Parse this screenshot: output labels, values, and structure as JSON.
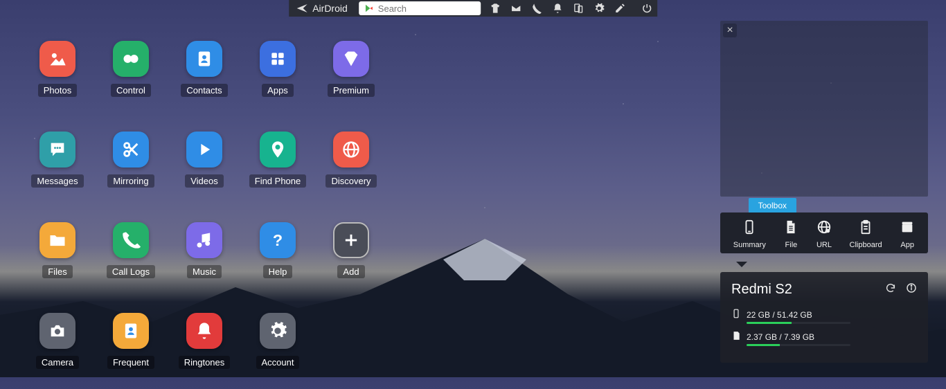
{
  "brand": {
    "name": "AirDroid"
  },
  "search": {
    "placeholder": "Search"
  },
  "apps": [
    {
      "label": "Photos",
      "name": "photos",
      "bg": "#ef5b4a",
      "icon": "photos"
    },
    {
      "label": "Control",
      "name": "control",
      "bg": "#25b06a",
      "icon": "binoculars"
    },
    {
      "label": "Contacts",
      "name": "contacts",
      "bg": "#2f8de6",
      "icon": "contact"
    },
    {
      "label": "Apps",
      "name": "apps",
      "bg": "#3c6fe0",
      "icon": "grid"
    },
    {
      "label": "Premium",
      "name": "premium",
      "bg": "#7d6be8",
      "icon": "diamond"
    },
    {
      "label": "Messages",
      "name": "messages",
      "bg": "#2f9fa8",
      "icon": "chat"
    },
    {
      "label": "Mirroring",
      "name": "mirroring",
      "bg": "#2f8de6",
      "icon": "scissors"
    },
    {
      "label": "Videos",
      "name": "videos",
      "bg": "#2f8de6",
      "icon": "play"
    },
    {
      "label": "Find Phone",
      "name": "find-phone",
      "bg": "#17b38f",
      "icon": "pin"
    },
    {
      "label": "Discovery",
      "name": "discovery",
      "bg": "#ef5b4a",
      "icon": "globe"
    },
    {
      "label": "Files",
      "name": "files",
      "bg": "#f4a93a",
      "icon": "folder"
    },
    {
      "label": "Call Logs",
      "name": "call-logs",
      "bg": "#25b06a",
      "icon": "phone"
    },
    {
      "label": "Music",
      "name": "music",
      "bg": "#7d6be8",
      "icon": "music"
    },
    {
      "label": "Help",
      "name": "help",
      "bg": "#2f8de6",
      "icon": "help"
    },
    {
      "label": "Add",
      "name": "add",
      "bg": "#4a4d58",
      "icon": "plus"
    },
    {
      "label": "Camera",
      "name": "camera",
      "bg": "#5f6470",
      "icon": "camera"
    },
    {
      "label": "Frequent",
      "name": "frequent",
      "bg": "#f4a93a",
      "icon": "contact"
    },
    {
      "label": "Ringtones",
      "name": "ringtones",
      "bg": "#e23b3b",
      "icon": "bell"
    },
    {
      "label": "Account",
      "name": "account",
      "bg": "#5f6470",
      "icon": "gear"
    }
  ],
  "toolbox": {
    "title": "Toolbox",
    "tools": [
      {
        "label": "Summary",
        "name": "summary",
        "icon": "phone-outline"
      },
      {
        "label": "File",
        "name": "file",
        "icon": "file"
      },
      {
        "label": "URL",
        "name": "url",
        "icon": "url"
      },
      {
        "label": "Clipboard",
        "name": "clipboard",
        "icon": "clipboard"
      },
      {
        "label": "App",
        "name": "app",
        "icon": "app"
      }
    ]
  },
  "device": {
    "name": "Redmi S2",
    "storage": [
      {
        "icon": "phone-outline",
        "used": "22 GB",
        "total": "51.42 GB",
        "pct": 43
      },
      {
        "icon": "sd",
        "used": "2.37 GB",
        "total": "7.39 GB",
        "pct": 32
      }
    ]
  }
}
